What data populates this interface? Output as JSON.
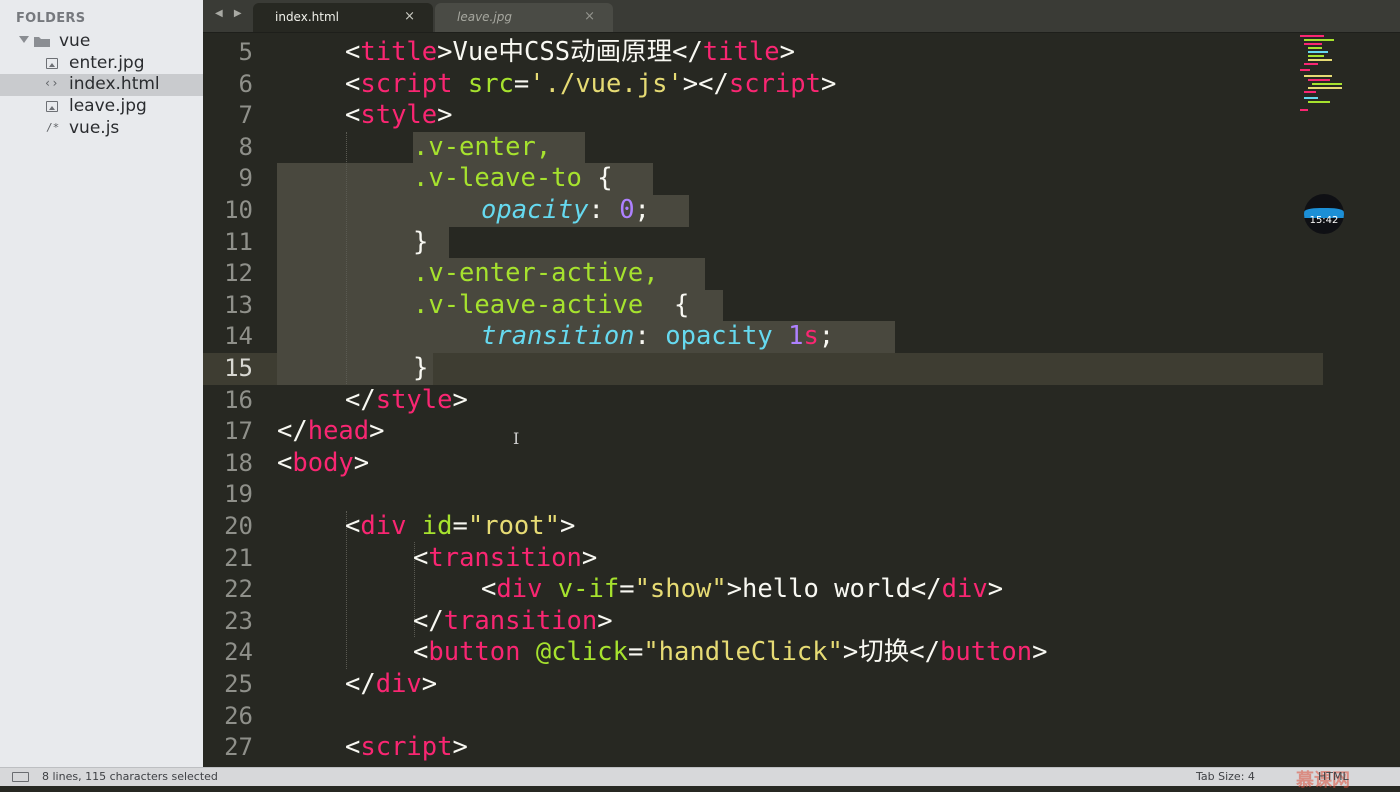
{
  "sidebar": {
    "title": "FOLDERS",
    "folder": "vue",
    "files": [
      {
        "name": "enter.jpg",
        "icon": "image-file-icon",
        "selected": false
      },
      {
        "name": "index.html",
        "icon": "code-file-icon",
        "selected": true
      },
      {
        "name": "leave.jpg",
        "icon": "image-file-icon",
        "selected": false
      },
      {
        "name": "vue.js",
        "icon": "script-file-icon",
        "selected": false
      }
    ]
  },
  "tabs": [
    {
      "label": "index.html",
      "active": true
    },
    {
      "label": "leave.jpg",
      "active": false
    }
  ],
  "tab_close": "×",
  "nav_arrows": "◀ ▶",
  "line_numbers": [
    "5",
    "6",
    "7",
    "8",
    "9",
    "10",
    "11",
    "12",
    "13",
    "14",
    "15",
    "16",
    "17",
    "18",
    "19",
    "20",
    "21",
    "22",
    "23",
    "24",
    "25",
    "26",
    "27"
  ],
  "current_line": "15",
  "code": {
    "l5": [
      "<",
      "title",
      ">Vue中CSS动画原理</",
      "title",
      ">"
    ],
    "l6": [
      "<",
      "script",
      " ",
      "src",
      "=",
      "'./vue.js'",
      "></",
      "script",
      ">"
    ],
    "l7": [
      "<",
      "style",
      ">"
    ],
    "l8": [
      ".v-enter,"
    ],
    "l9": [
      ".v-leave-to",
      " {"
    ],
    "l10": [
      "opacity",
      ": ",
      "0",
      ";"
    ],
    "l11": [
      "}"
    ],
    "l12": [
      ".v-enter-active,"
    ],
    "l13": [
      ".v-leave-active",
      "  {"
    ],
    "l14": [
      "transition",
      ": ",
      "opacity",
      " ",
      "1",
      "s",
      ";"
    ],
    "l15": [
      "}"
    ],
    "l16": [
      "</",
      "style",
      ">"
    ],
    "l17": [
      "</",
      "head",
      ">"
    ],
    "l18": [
      "<",
      "body",
      ">"
    ],
    "l20": [
      "<",
      "div",
      " ",
      "id",
      "=",
      "\"root\"",
      ">"
    ],
    "l21": [
      "<",
      "transition",
      ">"
    ],
    "l22": [
      "<",
      "div",
      " ",
      "v-if",
      "=",
      "\"show\"",
      ">hello world</",
      "div",
      ">"
    ],
    "l23": [
      "</",
      "transition",
      ">"
    ],
    "l24": [
      "<",
      "button",
      " ",
      "@click",
      "=",
      "\"handleClick\"",
      ">切换</",
      "button",
      ">"
    ],
    "l25": [
      "</",
      "div",
      ">"
    ],
    "l27": [
      "<",
      "script",
      ">"
    ]
  },
  "timer": "15:42",
  "status": {
    "selection": "8 lines, 115 characters selected",
    "tab_size": "Tab Size: 4",
    "syntax": "HTML",
    "brand": "慕课网"
  },
  "colors": {
    "background": "#272822",
    "tag": "#f92672",
    "attribute": "#a6e22e",
    "string": "#e6db74",
    "property": "#66d9ef",
    "number": "#ae81ff"
  }
}
